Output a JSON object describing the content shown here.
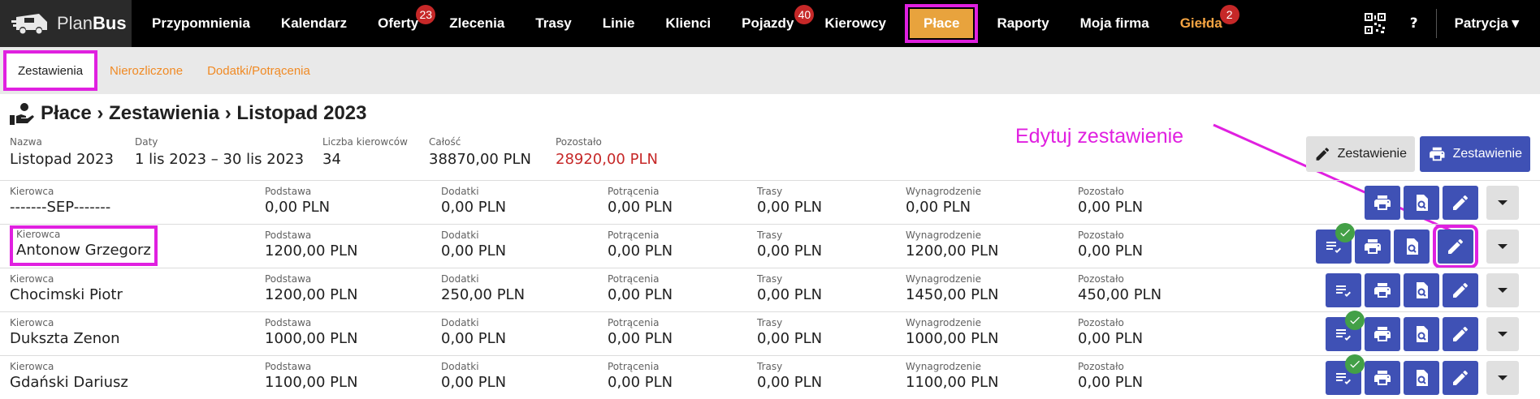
{
  "brand": {
    "plan": "Plan",
    "bus": "Bus"
  },
  "nav": {
    "items": [
      {
        "label": "Przypomnienia",
        "badge": ""
      },
      {
        "label": "Kalendarz",
        "badge": ""
      },
      {
        "label": "Oferty",
        "badge": "23"
      },
      {
        "label": "Zlecenia",
        "badge": ""
      },
      {
        "label": "Trasy",
        "badge": ""
      },
      {
        "label": "Linie",
        "badge": ""
      },
      {
        "label": "Klienci",
        "badge": ""
      },
      {
        "label": "Pojazdy",
        "badge": "40"
      },
      {
        "label": "Kierowcy",
        "badge": ""
      },
      {
        "label": "Płace",
        "badge": ""
      },
      {
        "label": "Raporty",
        "badge": ""
      },
      {
        "label": "Moja firma",
        "badge": ""
      },
      {
        "label": "Giełda",
        "badge": "2"
      }
    ],
    "help": "?",
    "user": "Patrycja ▾"
  },
  "subtabs": [
    "Zestawienia",
    "Nierozliczone",
    "Dodatki/Potrącenia"
  ],
  "header": {
    "title": "Płace › Zestawienia › Listopad 2023",
    "fields": [
      {
        "label": "Nazwa",
        "value": "Listopad 2023"
      },
      {
        "label": "Daty",
        "value": "1 lis 2023 – 30 lis 2023"
      },
      {
        "label": "Liczba kierowców",
        "value": "34"
      },
      {
        "label": "Całość",
        "value": "38870,00 PLN"
      },
      {
        "label": "Pozostało",
        "value": "28920,00 PLN"
      }
    ],
    "btn_edit": "Zestawienie",
    "btn_print": "Zestawienie"
  },
  "annotation": "Edytuj zestawienie",
  "columns": [
    "Kierowca",
    "Podstawa",
    "Dodatki",
    "Potrącenia",
    "Trasy",
    "Wynagrodzenie",
    "Pozostało"
  ],
  "rows": [
    {
      "name": "-------SEP-------",
      "base": "0,00 PLN",
      "extras": "0,00 PLN",
      "deduct": "0,00 PLN",
      "trips": "0,00 PLN",
      "salary": "0,00 PLN",
      "left": "0,00 PLN",
      "list": false,
      "check": false
    },
    {
      "name": "Antonow Grzegorz",
      "base": "1200,00 PLN",
      "extras": "0,00 PLN",
      "deduct": "0,00 PLN",
      "trips": "0,00 PLN",
      "salary": "1200,00 PLN",
      "left": "0,00 PLN",
      "list": true,
      "check": true
    },
    {
      "name": "Chocimski Piotr",
      "base": "1200,00 PLN",
      "extras": "250,00 PLN",
      "deduct": "0,00 PLN",
      "trips": "0,00 PLN",
      "salary": "1450,00 PLN",
      "left": "450,00 PLN",
      "list": true,
      "check": false
    },
    {
      "name": "Dukszta Zenon",
      "base": "1000,00 PLN",
      "extras": "0,00 PLN",
      "deduct": "0,00 PLN",
      "trips": "0,00 PLN",
      "salary": "1000,00 PLN",
      "left": "0,00 PLN",
      "list": true,
      "check": true
    },
    {
      "name": "Gdański Dariusz",
      "base": "1100,00 PLN",
      "extras": "0,00 PLN",
      "deduct": "0,00 PLN",
      "trips": "0,00 PLN",
      "salary": "1100,00 PLN",
      "left": "0,00 PLN",
      "list": true,
      "check": true
    }
  ],
  "colors": {
    "accent": "#3f51b5",
    "highlight": "#e020e0",
    "nav_active": "#e8a33d",
    "danger": "#c62828",
    "success": "#43a047"
  }
}
